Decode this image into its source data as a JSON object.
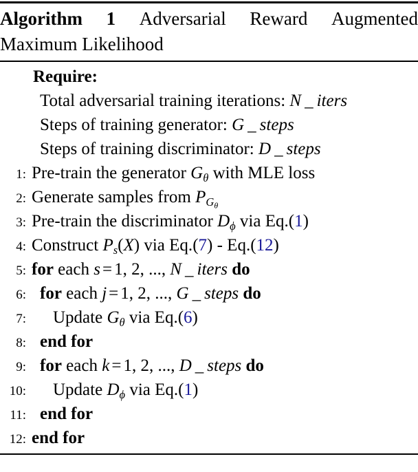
{
  "title": {
    "label": "Algorithm",
    "number": "1",
    "words_line1": [
      "Adversarial",
      "Reward",
      "Augmented"
    ],
    "line2": "Maximum Likelihood"
  },
  "require": {
    "heading": "Require:",
    "items": [
      {
        "text": "Total adversarial training iterations:",
        "math_base": "N",
        "math_sub": "iters"
      },
      {
        "text": "Steps of training generator:",
        "math_base": "G",
        "math_sub": "steps"
      },
      {
        "text": "Steps of training discriminator:",
        "math_base": "D",
        "math_sub": "steps"
      }
    ]
  },
  "steps": [
    {
      "number": "1:",
      "indent": 0,
      "parts": [
        {
          "type": "text",
          "value": "Pre-train the generator "
        },
        {
          "type": "mathsub",
          "base": "G",
          "sub": "θ"
        },
        {
          "type": "text",
          "value": " with MLE loss"
        }
      ]
    },
    {
      "number": "2:",
      "indent": 0,
      "parts": [
        {
          "type": "text",
          "value": "Generate samples from "
        },
        {
          "type": "mathsubsub",
          "base": "P",
          "sub": "G",
          "subsub": "θ"
        }
      ]
    },
    {
      "number": "3:",
      "indent": 0,
      "parts": [
        {
          "type": "text",
          "value": "Pre-train the discriminator "
        },
        {
          "type": "mathsub",
          "base": "D",
          "sub": "ϕ"
        },
        {
          "type": "text",
          "value": " via Eq."
        },
        {
          "type": "eqref",
          "value": "1"
        }
      ]
    },
    {
      "number": "4:",
      "indent": 0,
      "parts": [
        {
          "type": "text",
          "value": "Construct "
        },
        {
          "type": "mathsub",
          "base": "P",
          "sub": "s"
        },
        {
          "type": "mathparen",
          "value": "X"
        },
        {
          "type": "text",
          "value": " via Eq."
        },
        {
          "type": "eqref",
          "value": "7"
        },
        {
          "type": "text",
          "value": " - Eq."
        },
        {
          "type": "eqref",
          "value": "12"
        }
      ]
    },
    {
      "number": "5:",
      "indent": 0,
      "parts": [
        {
          "type": "kw",
          "value": "for"
        },
        {
          "type": "text",
          "value": " each "
        },
        {
          "type": "range",
          "var": "s",
          "from": "1",
          "second": "2",
          "ellipsis": "...",
          "limit_base": "N",
          "limit_sub": "iters"
        },
        {
          "type": "text",
          "value": " "
        },
        {
          "type": "kw",
          "value": "do"
        }
      ]
    },
    {
      "number": "6:",
      "indent": 1,
      "parts": [
        {
          "type": "kw",
          "value": "for"
        },
        {
          "type": "text",
          "value": " each "
        },
        {
          "type": "range",
          "var": "j",
          "from": "1",
          "second": "2",
          "ellipsis": "...",
          "limit_base": "G",
          "limit_sub": "steps"
        },
        {
          "type": "text",
          "value": " "
        },
        {
          "type": "kw",
          "value": "do"
        }
      ]
    },
    {
      "number": "7:",
      "indent": 2,
      "parts": [
        {
          "type": "text",
          "value": "Update "
        },
        {
          "type": "mathsub",
          "base": "G",
          "sub": "θ"
        },
        {
          "type": "text",
          "value": " via Eq."
        },
        {
          "type": "eqref",
          "value": "6"
        }
      ]
    },
    {
      "number": "8:",
      "indent": 1,
      "parts": [
        {
          "type": "kw",
          "value": "end for"
        }
      ]
    },
    {
      "number": "9:",
      "indent": 1,
      "parts": [
        {
          "type": "kw",
          "value": "for"
        },
        {
          "type": "text",
          "value": " each "
        },
        {
          "type": "range",
          "var": "k",
          "from": "1",
          "second": "2",
          "ellipsis": "...",
          "limit_base": "D",
          "limit_sub": "steps"
        },
        {
          "type": "text",
          "value": " "
        },
        {
          "type": "kw",
          "value": "do"
        }
      ]
    },
    {
      "number": "10:",
      "indent": 2,
      "parts": [
        {
          "type": "text",
          "value": "Update "
        },
        {
          "type": "mathsub",
          "base": "D",
          "sub": "ϕ"
        },
        {
          "type": "text",
          "value": " via Eq."
        },
        {
          "type": "eqref",
          "value": "1"
        }
      ]
    },
    {
      "number": "11:",
      "indent": 1,
      "parts": [
        {
          "type": "kw",
          "value": "end for"
        }
      ]
    },
    {
      "number": "12:",
      "indent": 0,
      "parts": [
        {
          "type": "kw",
          "value": "end for"
        }
      ]
    }
  ],
  "colors": {
    "text": "#000000",
    "eqref_link": "#1a1a99",
    "rule": "#000000"
  }
}
